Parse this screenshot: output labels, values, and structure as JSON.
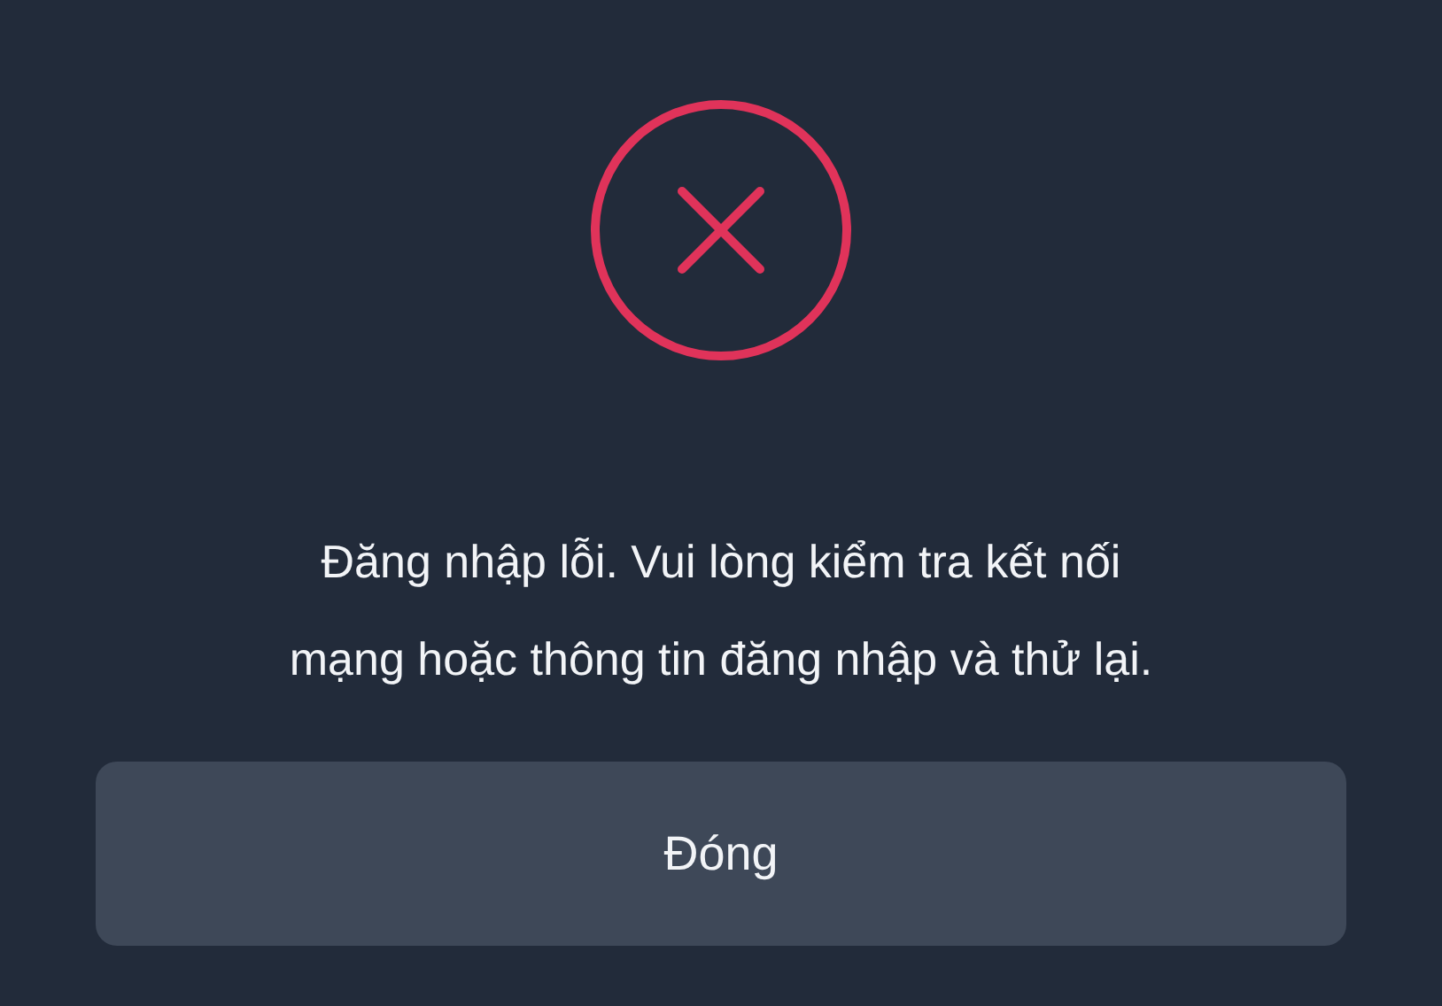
{
  "dialog": {
    "message": "Đăng nhập lỗi. Vui lòng kiểm tra kết nối mạng hoặc thông tin đăng nhập và thử lại.",
    "button": "Đóng"
  }
}
